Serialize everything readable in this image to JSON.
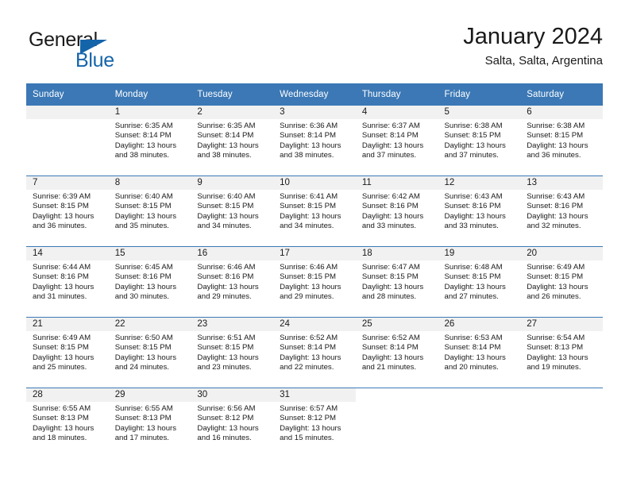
{
  "logo": {
    "word_top": "General",
    "word_bottom": "Blue",
    "triangle_icon": "triangle-icon",
    "brand_color": "#1464aa"
  },
  "header": {
    "title": "January 2024",
    "subtitle": "Salta, Salta, Argentina"
  },
  "theme": {
    "header_bg": "#3b78b5",
    "daynum_bg": "#f1f1f1",
    "text": "#1a1a1a"
  },
  "calendar": {
    "weekday_headers": [
      "Sunday",
      "Monday",
      "Tuesday",
      "Wednesday",
      "Thursday",
      "Friday",
      "Saturday"
    ],
    "labels": {
      "sunrise": "Sunrise:",
      "sunset": "Sunset:",
      "daylight": "Daylight:"
    },
    "weeks": [
      [
        {
          "day": "",
          "sunrise": "",
          "sunset": "",
          "daylight_1": "",
          "daylight_2": ""
        },
        {
          "day": "1",
          "sunrise": "Sunrise: 6:35 AM",
          "sunset": "Sunset: 8:14 PM",
          "daylight_1": "Daylight: 13 hours",
          "daylight_2": "and 38 minutes."
        },
        {
          "day": "2",
          "sunrise": "Sunrise: 6:35 AM",
          "sunset": "Sunset: 8:14 PM",
          "daylight_1": "Daylight: 13 hours",
          "daylight_2": "and 38 minutes."
        },
        {
          "day": "3",
          "sunrise": "Sunrise: 6:36 AM",
          "sunset": "Sunset: 8:14 PM",
          "daylight_1": "Daylight: 13 hours",
          "daylight_2": "and 38 minutes."
        },
        {
          "day": "4",
          "sunrise": "Sunrise: 6:37 AM",
          "sunset": "Sunset: 8:14 PM",
          "daylight_1": "Daylight: 13 hours",
          "daylight_2": "and 37 minutes."
        },
        {
          "day": "5",
          "sunrise": "Sunrise: 6:38 AM",
          "sunset": "Sunset: 8:15 PM",
          "daylight_1": "Daylight: 13 hours",
          "daylight_2": "and 37 minutes."
        },
        {
          "day": "6",
          "sunrise": "Sunrise: 6:38 AM",
          "sunset": "Sunset: 8:15 PM",
          "daylight_1": "Daylight: 13 hours",
          "daylight_2": "and 36 minutes."
        }
      ],
      [
        {
          "day": "7",
          "sunrise": "Sunrise: 6:39 AM",
          "sunset": "Sunset: 8:15 PM",
          "daylight_1": "Daylight: 13 hours",
          "daylight_2": "and 36 minutes."
        },
        {
          "day": "8",
          "sunrise": "Sunrise: 6:40 AM",
          "sunset": "Sunset: 8:15 PM",
          "daylight_1": "Daylight: 13 hours",
          "daylight_2": "and 35 minutes."
        },
        {
          "day": "9",
          "sunrise": "Sunrise: 6:40 AM",
          "sunset": "Sunset: 8:15 PM",
          "daylight_1": "Daylight: 13 hours",
          "daylight_2": "and 34 minutes."
        },
        {
          "day": "10",
          "sunrise": "Sunrise: 6:41 AM",
          "sunset": "Sunset: 8:15 PM",
          "daylight_1": "Daylight: 13 hours",
          "daylight_2": "and 34 minutes."
        },
        {
          "day": "11",
          "sunrise": "Sunrise: 6:42 AM",
          "sunset": "Sunset: 8:16 PM",
          "daylight_1": "Daylight: 13 hours",
          "daylight_2": "and 33 minutes."
        },
        {
          "day": "12",
          "sunrise": "Sunrise: 6:43 AM",
          "sunset": "Sunset: 8:16 PM",
          "daylight_1": "Daylight: 13 hours",
          "daylight_2": "and 33 minutes."
        },
        {
          "day": "13",
          "sunrise": "Sunrise: 6:43 AM",
          "sunset": "Sunset: 8:16 PM",
          "daylight_1": "Daylight: 13 hours",
          "daylight_2": "and 32 minutes."
        }
      ],
      [
        {
          "day": "14",
          "sunrise": "Sunrise: 6:44 AM",
          "sunset": "Sunset: 8:16 PM",
          "daylight_1": "Daylight: 13 hours",
          "daylight_2": "and 31 minutes."
        },
        {
          "day": "15",
          "sunrise": "Sunrise: 6:45 AM",
          "sunset": "Sunset: 8:16 PM",
          "daylight_1": "Daylight: 13 hours",
          "daylight_2": "and 30 minutes."
        },
        {
          "day": "16",
          "sunrise": "Sunrise: 6:46 AM",
          "sunset": "Sunset: 8:16 PM",
          "daylight_1": "Daylight: 13 hours",
          "daylight_2": "and 29 minutes."
        },
        {
          "day": "17",
          "sunrise": "Sunrise: 6:46 AM",
          "sunset": "Sunset: 8:15 PM",
          "daylight_1": "Daylight: 13 hours",
          "daylight_2": "and 29 minutes."
        },
        {
          "day": "18",
          "sunrise": "Sunrise: 6:47 AM",
          "sunset": "Sunset: 8:15 PM",
          "daylight_1": "Daylight: 13 hours",
          "daylight_2": "and 28 minutes."
        },
        {
          "day": "19",
          "sunrise": "Sunrise: 6:48 AM",
          "sunset": "Sunset: 8:15 PM",
          "daylight_1": "Daylight: 13 hours",
          "daylight_2": "and 27 minutes."
        },
        {
          "day": "20",
          "sunrise": "Sunrise: 6:49 AM",
          "sunset": "Sunset: 8:15 PM",
          "daylight_1": "Daylight: 13 hours",
          "daylight_2": "and 26 minutes."
        }
      ],
      [
        {
          "day": "21",
          "sunrise": "Sunrise: 6:49 AM",
          "sunset": "Sunset: 8:15 PM",
          "daylight_1": "Daylight: 13 hours",
          "daylight_2": "and 25 minutes."
        },
        {
          "day": "22",
          "sunrise": "Sunrise: 6:50 AM",
          "sunset": "Sunset: 8:15 PM",
          "daylight_1": "Daylight: 13 hours",
          "daylight_2": "and 24 minutes."
        },
        {
          "day": "23",
          "sunrise": "Sunrise: 6:51 AM",
          "sunset": "Sunset: 8:15 PM",
          "daylight_1": "Daylight: 13 hours",
          "daylight_2": "and 23 minutes."
        },
        {
          "day": "24",
          "sunrise": "Sunrise: 6:52 AM",
          "sunset": "Sunset: 8:14 PM",
          "daylight_1": "Daylight: 13 hours",
          "daylight_2": "and 22 minutes."
        },
        {
          "day": "25",
          "sunrise": "Sunrise: 6:52 AM",
          "sunset": "Sunset: 8:14 PM",
          "daylight_1": "Daylight: 13 hours",
          "daylight_2": "and 21 minutes."
        },
        {
          "day": "26",
          "sunrise": "Sunrise: 6:53 AM",
          "sunset": "Sunset: 8:14 PM",
          "daylight_1": "Daylight: 13 hours",
          "daylight_2": "and 20 minutes."
        },
        {
          "day": "27",
          "sunrise": "Sunrise: 6:54 AM",
          "sunset": "Sunset: 8:13 PM",
          "daylight_1": "Daylight: 13 hours",
          "daylight_2": "and 19 minutes."
        }
      ],
      [
        {
          "day": "28",
          "sunrise": "Sunrise: 6:55 AM",
          "sunset": "Sunset: 8:13 PM",
          "daylight_1": "Daylight: 13 hours",
          "daylight_2": "and 18 minutes."
        },
        {
          "day": "29",
          "sunrise": "Sunrise: 6:55 AM",
          "sunset": "Sunset: 8:13 PM",
          "daylight_1": "Daylight: 13 hours",
          "daylight_2": "and 17 minutes."
        },
        {
          "day": "30",
          "sunrise": "Sunrise: 6:56 AM",
          "sunset": "Sunset: 8:12 PM",
          "daylight_1": "Daylight: 13 hours",
          "daylight_2": "and 16 minutes."
        },
        {
          "day": "31",
          "sunrise": "Sunrise: 6:57 AM",
          "sunset": "Sunset: 8:12 PM",
          "daylight_1": "Daylight: 13 hours",
          "daylight_2": "and 15 minutes."
        },
        {
          "day": "",
          "sunrise": "",
          "sunset": "",
          "daylight_1": "",
          "daylight_2": ""
        },
        {
          "day": "",
          "sunrise": "",
          "sunset": "",
          "daylight_1": "",
          "daylight_2": ""
        },
        {
          "day": "",
          "sunrise": "",
          "sunset": "",
          "daylight_1": "",
          "daylight_2": ""
        }
      ]
    ]
  }
}
